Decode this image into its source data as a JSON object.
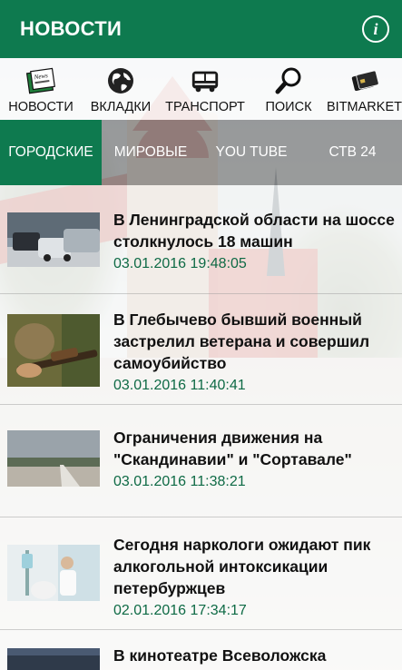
{
  "app": {
    "title": "НОВОСТИ",
    "info_icon": "info-icon"
  },
  "nav": {
    "items": [
      {
        "label": "НОВОСТИ",
        "icon": "news-icon"
      },
      {
        "label": "ВКЛАДКИ",
        "icon": "globe-icon"
      },
      {
        "label": "ТРАНСПОРТ",
        "icon": "bus-icon"
      },
      {
        "label": "ПОИСК",
        "icon": "magnifier-icon"
      },
      {
        "label": "BITMARKET",
        "icon": "cards-icon"
      }
    ]
  },
  "tabs": {
    "items": [
      {
        "label": "ГОРОДСКИЕ",
        "active": true
      },
      {
        "label": "МИРОВЫЕ",
        "active": false
      },
      {
        "label": "YOU TUBE",
        "active": false
      },
      {
        "label": "СТВ 24",
        "active": false
      }
    ]
  },
  "news": [
    {
      "title": "В Ленинградской области на шоссе столкнулось 18 машин",
      "date": "03.01.2016 19:48:05"
    },
    {
      "title": "В Глебычево бывший военный застрелил ветерана и совершил самоубийство",
      "date": "03.01.2016 11:40:41"
    },
    {
      "title": "Ограничения движения на \"Скандинавии\" и \"Сортавале\"",
      "date": "03.01.2016 11:38:21"
    },
    {
      "title": "Сегодня наркологи ожидают пик алкогольной интоксикации петербуржцев",
      "date": "02.01.2016 17:34:17"
    },
    {
      "title": "В кинотеатре Всеволожска",
      "date": ""
    }
  ],
  "colors": {
    "accent": "#0e7a4f",
    "date_text": "#0e6a45"
  }
}
